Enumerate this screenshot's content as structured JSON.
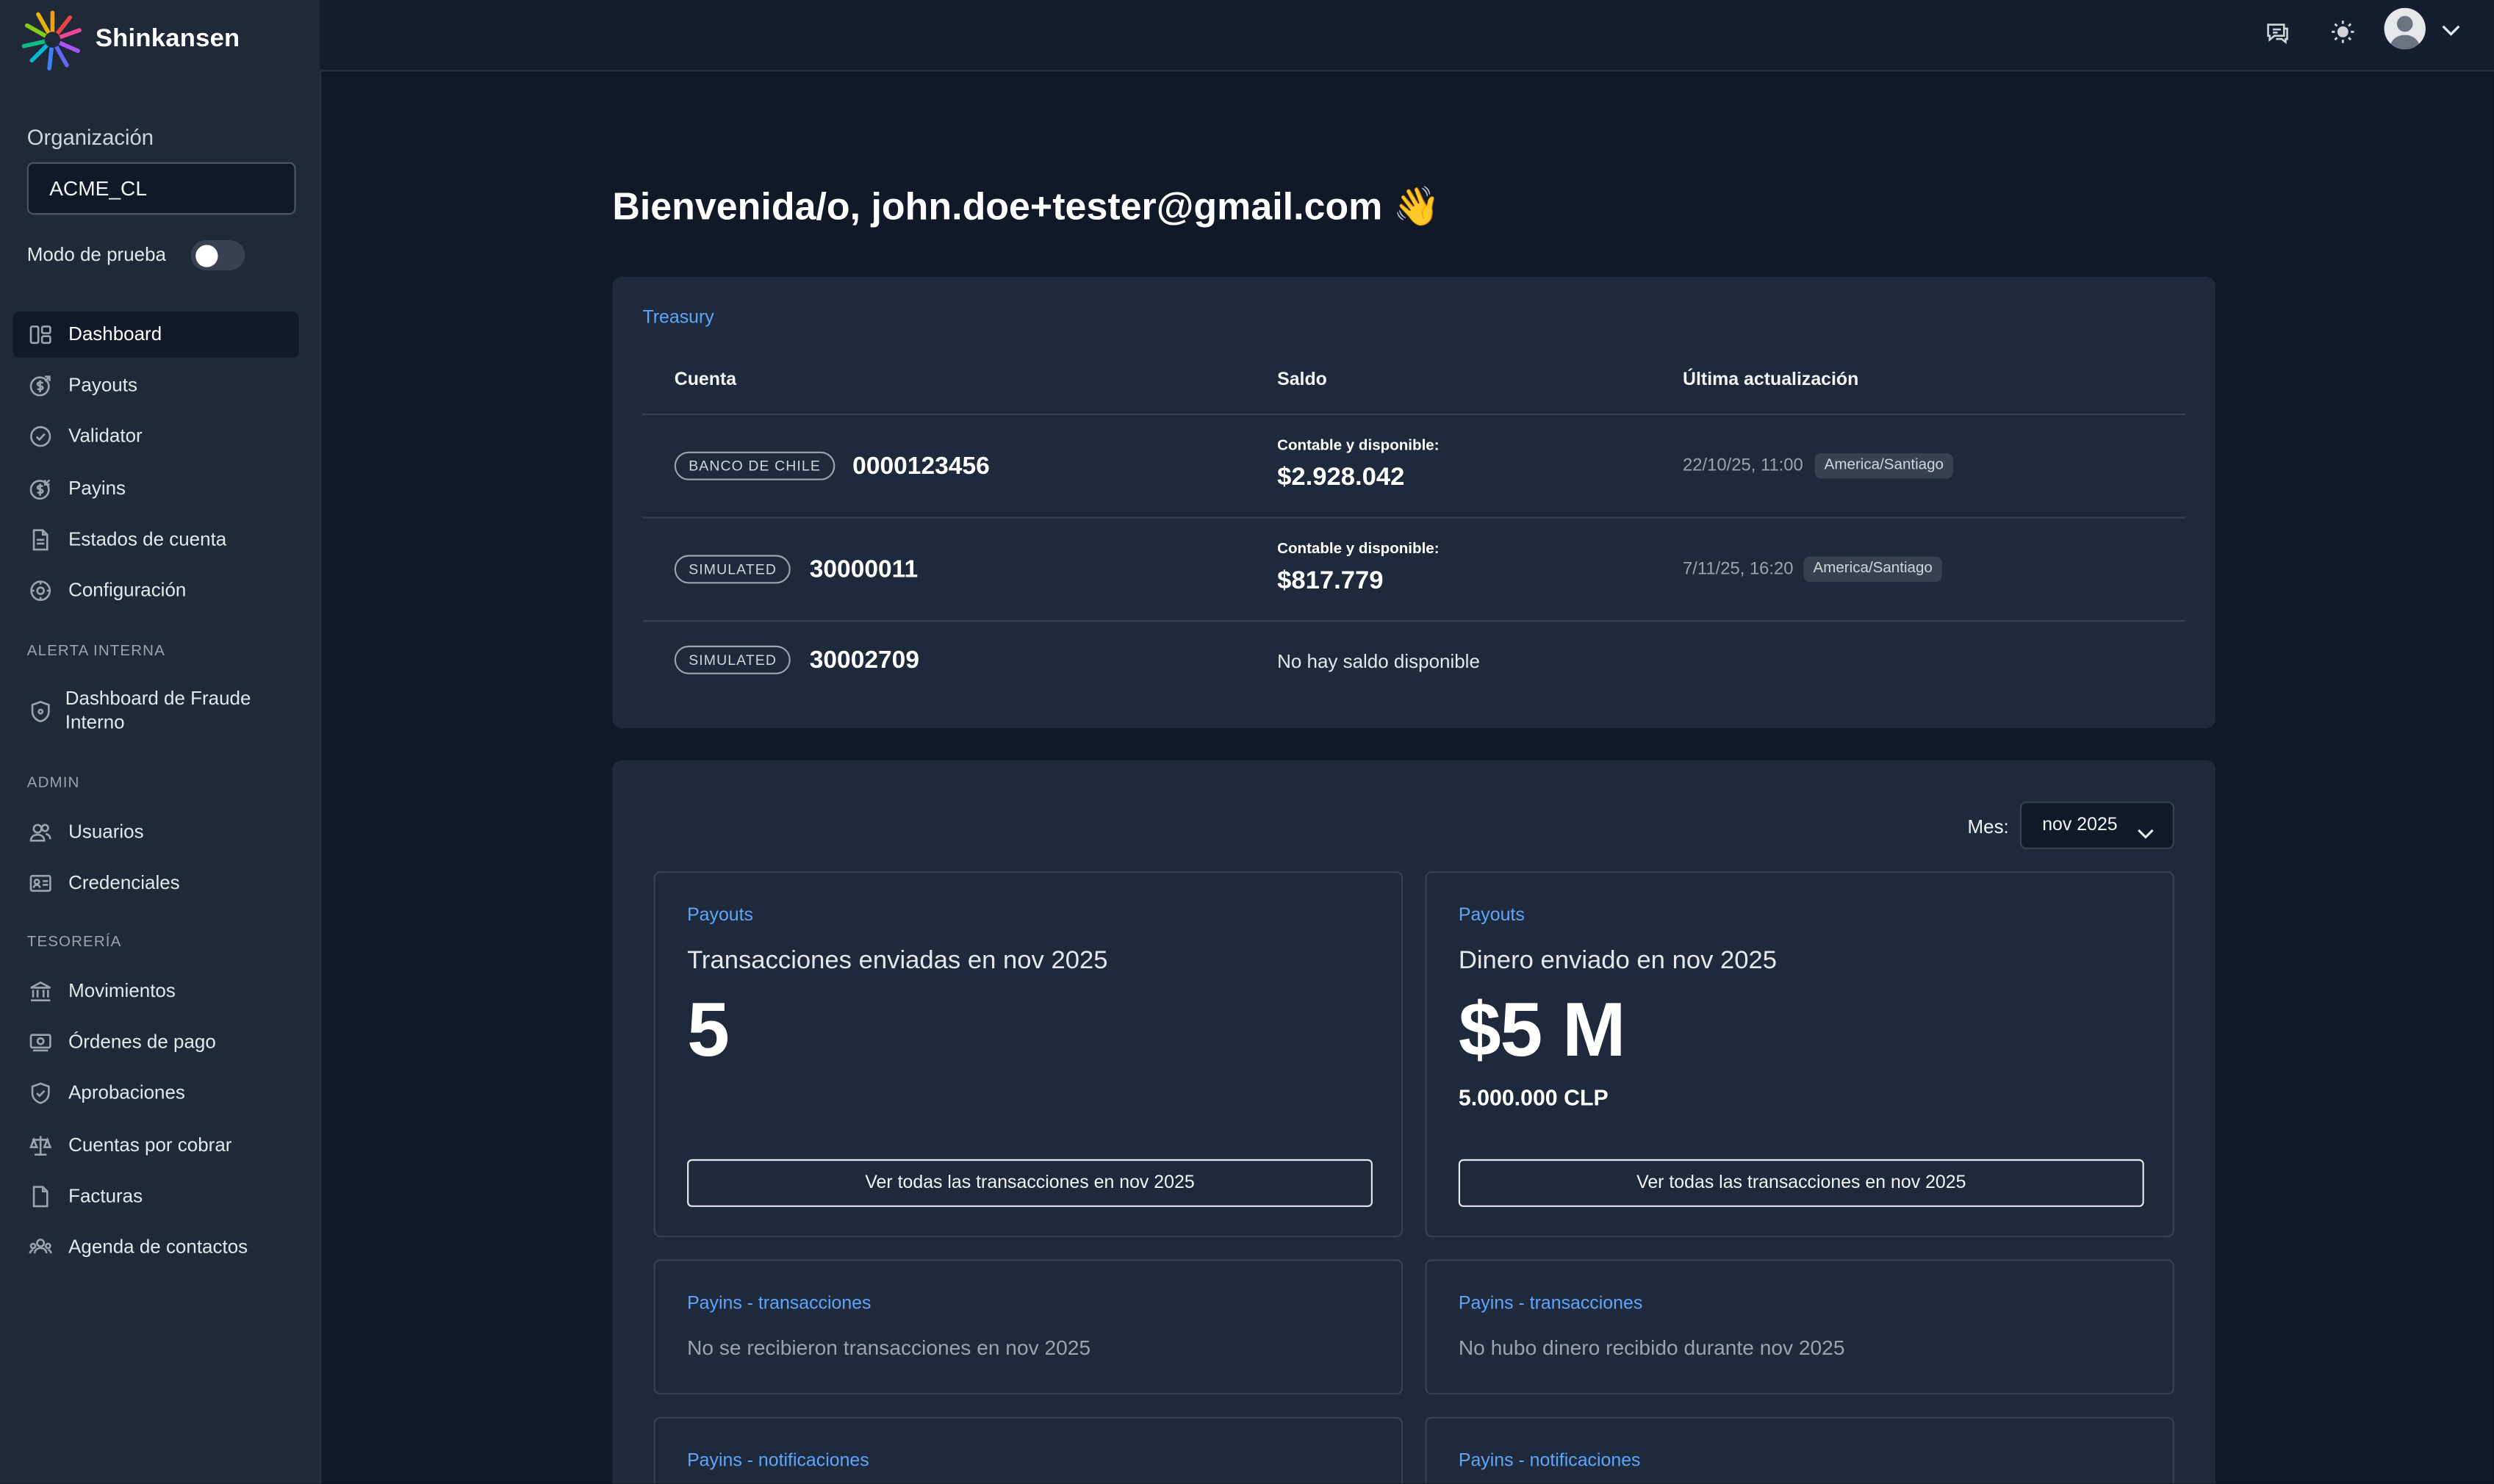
{
  "app": {
    "name": "Shinkansen"
  },
  "sidebar": {
    "org_label": "Organización",
    "org_value": "ACME_CL",
    "test_mode_label": "Modo de prueba",
    "test_mode_on": false,
    "main_items": [
      {
        "label": "Dashboard",
        "icon": "dashboard-icon",
        "active": true
      },
      {
        "label": "Payouts",
        "icon": "payouts-icon"
      },
      {
        "label": "Validator",
        "icon": "check-circle-icon"
      },
      {
        "label": "Payins",
        "icon": "payins-icon"
      },
      {
        "label": "Estados de cuenta",
        "icon": "document-icon"
      },
      {
        "label": "Configuración",
        "icon": "gear-icon"
      }
    ],
    "alert_section": "ALERTA INTERNA",
    "alert_items": [
      {
        "label_line1": "Dashboard de Fraude",
        "label_line2": "Interno",
        "icon": "shield-icon"
      }
    ],
    "admin_section": "ADMIN",
    "admin_items": [
      {
        "label": "Usuarios",
        "icon": "users-icon"
      },
      {
        "label": "Credenciales",
        "icon": "id-card-icon"
      }
    ],
    "treasury_section": "TESORERÍA",
    "treasury_items": [
      {
        "label": "Movimientos",
        "icon": "bank-icon"
      },
      {
        "label": "Órdenes de pago",
        "icon": "money-icon"
      },
      {
        "label": "Aprobaciones",
        "icon": "shield-check-icon"
      },
      {
        "label": "Cuentas por cobrar",
        "icon": "scale-icon"
      },
      {
        "label": "Facturas",
        "icon": "invoice-icon"
      },
      {
        "label": "Agenda de contactos",
        "icon": "contacts-icon"
      }
    ]
  },
  "header": {
    "welcome": "Bienvenida/o, john.doe+tester@gmail.com 👋"
  },
  "treasury": {
    "label": "Treasury",
    "columns": {
      "account": "Cuenta",
      "balance": "Saldo",
      "updated": "Última actualización"
    },
    "rows": [
      {
        "bank": "BANCO DE CHILE",
        "number": "0000123456",
        "balance_label": "Contable y disponible:",
        "balance": "$2.928.042",
        "date": "22/10/25, 11:00",
        "tz": "America/Santiago"
      },
      {
        "bank": "SIMULATED",
        "number": "30000011",
        "balance_label": "Contable y disponible:",
        "balance": "$817.779",
        "date": "7/11/25, 16:20",
        "tz": "America/Santiago"
      },
      {
        "bank": "SIMULATED",
        "number": "30002709",
        "no_balance": "No hay saldo disponible"
      }
    ]
  },
  "stats": {
    "month_label": "Mes:",
    "month_value": "nov 2025",
    "panels": {
      "payouts_count": {
        "kicker": "Payouts",
        "title": "Transacciones enviadas en nov 2025",
        "value": "5",
        "button": "Ver todas las transacciones en nov 2025"
      },
      "payouts_amount": {
        "kicker": "Payouts",
        "title": "Dinero enviado en nov 2025",
        "value": "$5 M",
        "sub": "5.000.000 CLP",
        "button": "Ver todas las transacciones en nov 2025"
      },
      "payins_tx_left": {
        "kicker": "Payins - transacciones",
        "empty": "No se recibieron transacciones en nov 2025"
      },
      "payins_tx_right": {
        "kicker": "Payins - transacciones",
        "empty": "No hubo dinero recibido durante nov 2025"
      },
      "payins_notif_left": {
        "kicker": "Payins - notificaciones"
      },
      "payins_notif_right": {
        "kicker": "Payins - notificaciones"
      }
    }
  }
}
